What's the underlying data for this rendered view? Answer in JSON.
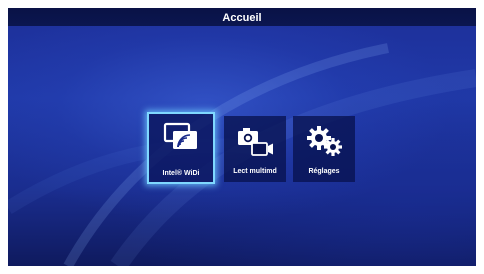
{
  "header": {
    "title": "Accueil"
  },
  "menu": {
    "items": [
      {
        "label": "Intel® WiDi",
        "icon": "widi-icon",
        "selected": true
      },
      {
        "label": "Lect multimd",
        "icon": "multimedia-icon",
        "selected": false
      },
      {
        "label": "Réglages",
        "icon": "settings-gears-icon",
        "selected": false
      }
    ]
  },
  "colors": {
    "background": "#2039a8",
    "title_bar": "#0a1246",
    "tile": "#081250",
    "selection_glow": "#7fd8ff",
    "text": "#ffffff"
  }
}
